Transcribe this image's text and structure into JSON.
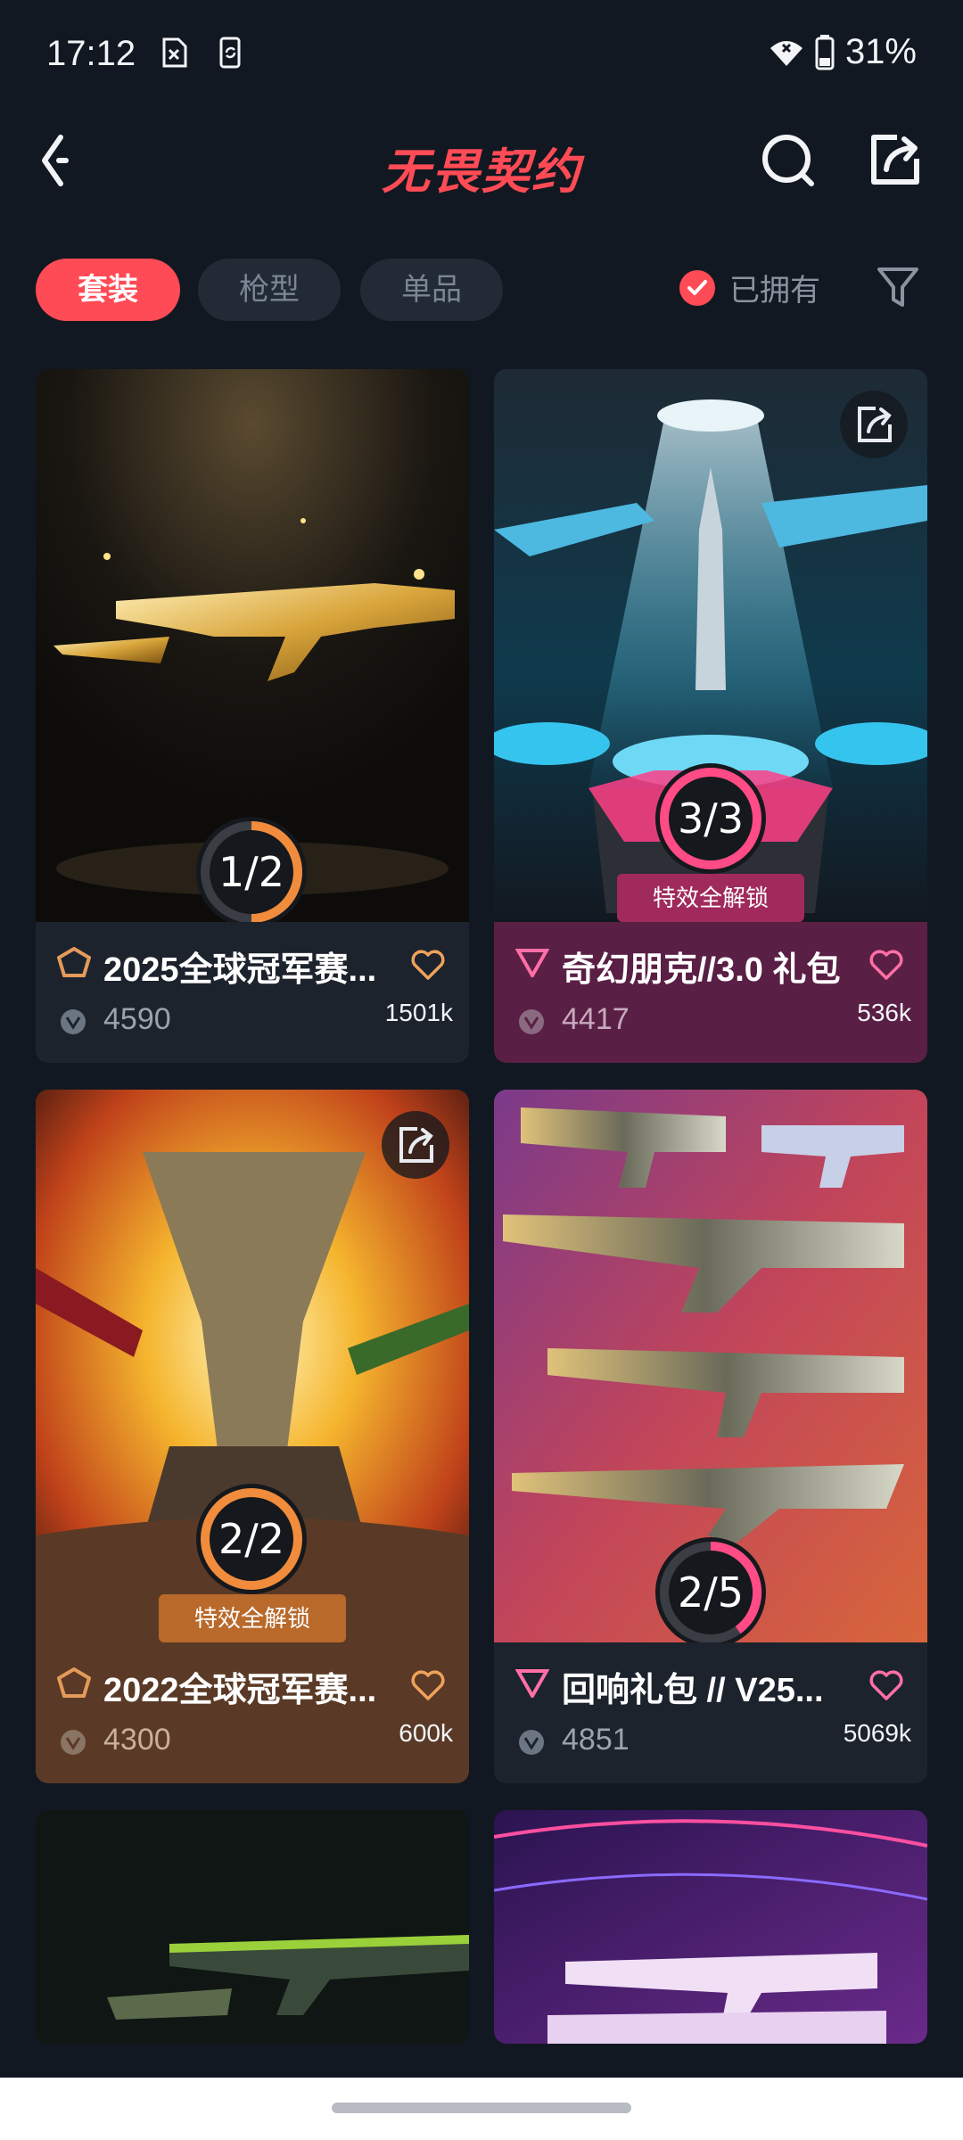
{
  "status": {
    "time": "17:12",
    "battery": "31%"
  },
  "header": {
    "title": "无畏契约"
  },
  "filters": {
    "tabs": [
      "套装",
      "枪型",
      "单品"
    ],
    "owned_label": "已拥有"
  },
  "colors": {
    "accent": "#ff4b55",
    "bg": "#121821"
  },
  "cards": [
    {
      "name": "2025全球冠军赛...",
      "price": "4590",
      "likes": "1501k",
      "progress": "1/2",
      "progress_value": 0.5,
      "badge": "",
      "has_share": false
    },
    {
      "name": "奇幻朋克//3.0 礼包",
      "price": "4417",
      "likes": "536k",
      "progress": "3/3",
      "progress_value": 1.0,
      "badge": "特效全解锁",
      "has_share": true
    },
    {
      "name": "2022全球冠军赛...",
      "price": "4300",
      "likes": "600k",
      "progress": "2/2",
      "progress_value": 1.0,
      "badge": "特效全解锁",
      "has_share": true
    },
    {
      "name": "回响礼包 // V25...",
      "price": "4851",
      "likes": "5069k",
      "progress": "2/5",
      "progress_value": 0.4,
      "badge": "",
      "has_share": false
    }
  ]
}
